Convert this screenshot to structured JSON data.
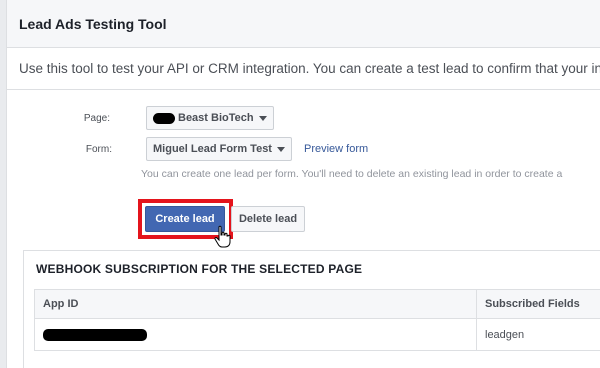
{
  "header": {
    "title": "Lead Ads Testing Tool"
  },
  "intro": {
    "text": "Use this tool to test your API or CRM integration. You can create a test lead to confirm that your inte"
  },
  "form": {
    "page_label": "Page:",
    "page_value": "Beast BioTech",
    "form_label": "Form:",
    "form_value": "Miguel Lead Form Test",
    "preview_link": "Preview form",
    "hint": "You can create one lead per form. You'll need to delete an existing lead in order to create a"
  },
  "actions": {
    "create_label": "Create lead",
    "delete_label": "Delete lead"
  },
  "webhook": {
    "title": "WEBHOOK SUBSCRIPTION FOR THE SELECTED PAGE",
    "columns": [
      "App ID",
      "Subscribed Fields"
    ],
    "rows": [
      {
        "subscribed_fields": "leadgen"
      }
    ]
  },
  "colors": {
    "primary": "#4267b2",
    "highlight": "#e4141c",
    "link": "#365899"
  }
}
